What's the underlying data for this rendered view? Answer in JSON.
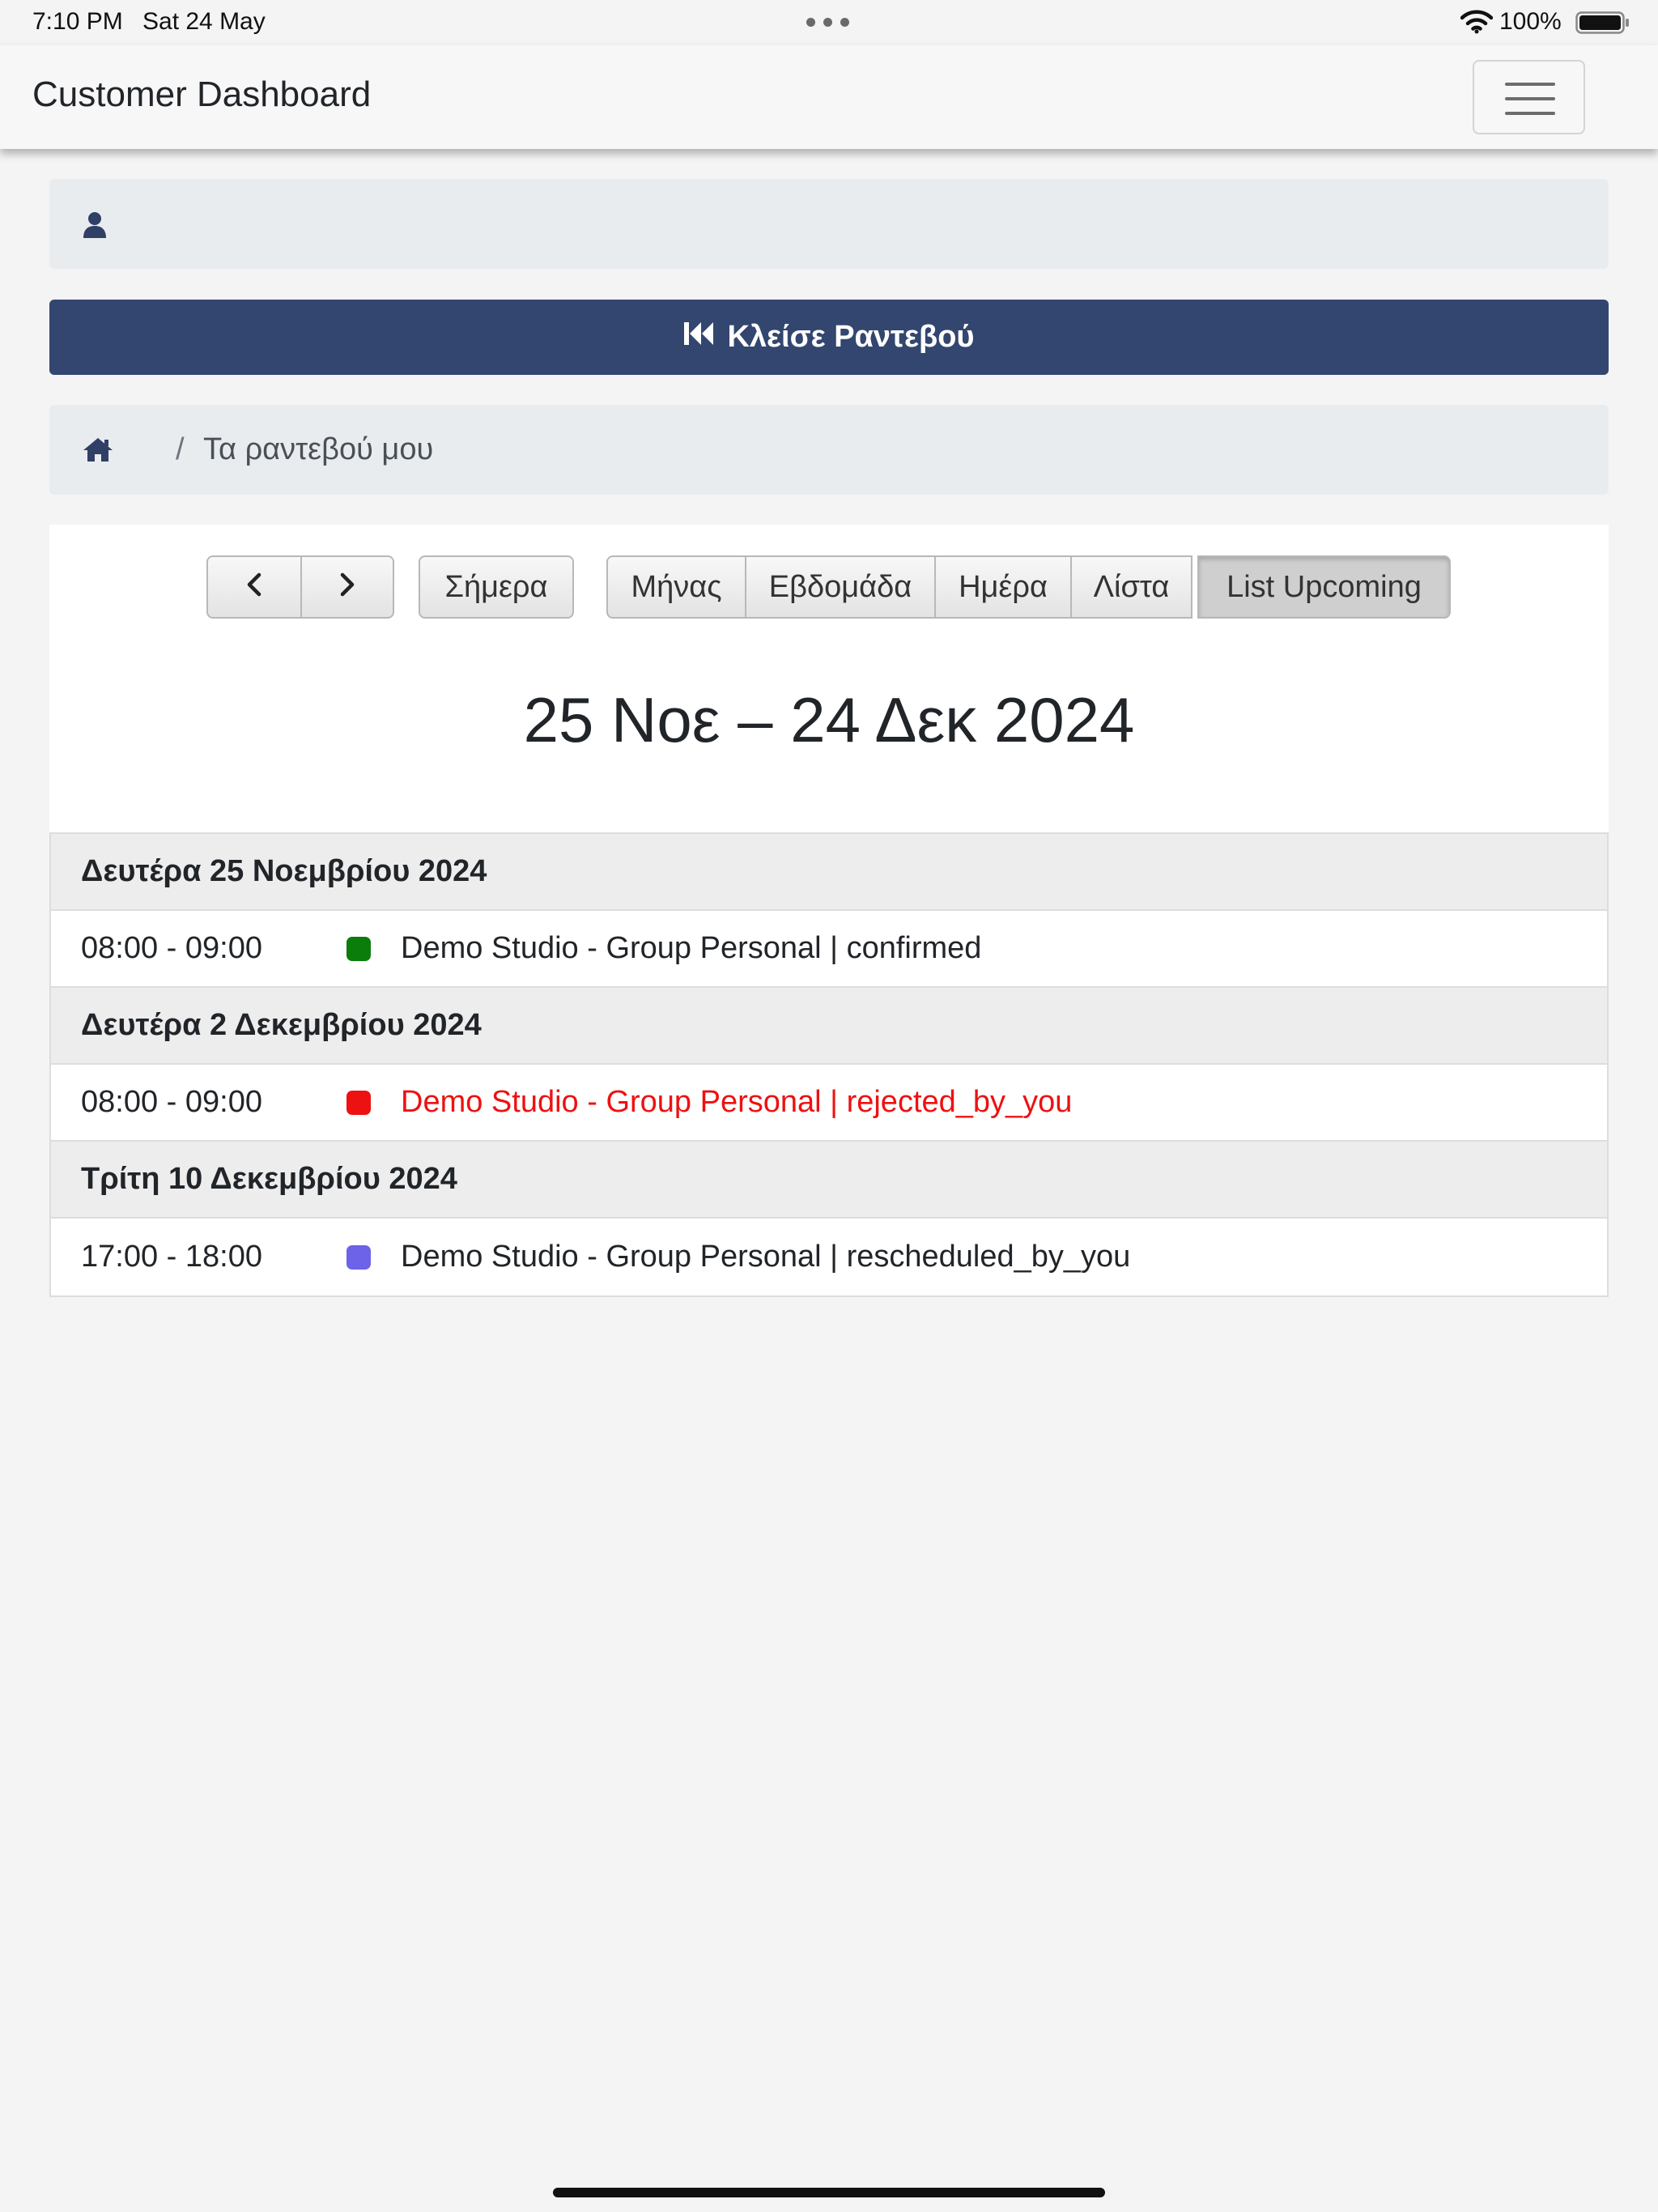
{
  "status_bar": {
    "time": "7:10 PM",
    "date": "Sat 24 May",
    "battery": "100%"
  },
  "navbar": {
    "brand": "Customer Dashboard",
    "toggler_icon": "hamburger-menu-icon"
  },
  "user_bar": {
    "icon": "user-icon"
  },
  "book_button": {
    "icon": "fast-backward-icon",
    "label": "Κλείσε Ραντεβού"
  },
  "breadcrumb": {
    "home_icon": "home-icon",
    "separator": "/",
    "current": "Τα ραντεβού μου"
  },
  "calendar": {
    "prev_icon": "chevron-left-icon",
    "next_icon": "chevron-right-icon",
    "today_label": "Σήμερα",
    "views": [
      "Μήνας",
      "Εβδομάδα",
      "Ημέρα",
      "Λίστα",
      "List Upcoming"
    ],
    "active_view": "List Upcoming",
    "title": "25 Νοε – 24 Δεκ 2024"
  },
  "colors": {
    "primary": "#33466f",
    "confirmed": "#0b7d0b",
    "rejected": "#ee1111",
    "rescheduled": "#6c63e8"
  },
  "event_list": [
    {
      "day": "Δευτέρα 25 Νοεμβρίου 2024",
      "events": [
        {
          "time": "08:00 - 09:00",
          "title": "Demo Studio - Group Personal | confirmed",
          "dot_color": "#0b7d0b",
          "text_color": "#212529"
        }
      ]
    },
    {
      "day": "Δευτέρα 2 Δεκεμβρίου 2024",
      "events": [
        {
          "time": "08:00 - 09:00",
          "title": "Demo Studio - Group Personal | rejected_by_you",
          "dot_color": "#ee1111",
          "text_color": "#ee1111"
        }
      ]
    },
    {
      "day": "Τρίτη 10 Δεκεμβρίου 2024",
      "events": [
        {
          "time": "17:00 - 18:00",
          "title": "Demo Studio - Group Personal | rescheduled_by_you",
          "dot_color": "#6c63e8",
          "text_color": "#212529"
        }
      ]
    }
  ]
}
